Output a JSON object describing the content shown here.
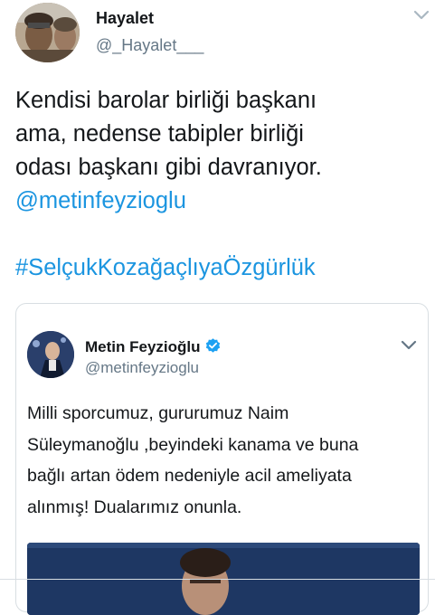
{
  "tweet": {
    "author_name": "Hayalet",
    "author_handle": "@_Hayalet___",
    "text_lines": [
      "Kendisi barolar birliği başkanı",
      "ama, nedense tabipler birliği",
      "odası başkanı gibi davranıyor."
    ],
    "mention": "@metinfeyzioglu",
    "hashtag": "#SelçukKozağaçlıyaÖzgürlük"
  },
  "quoted_tweet": {
    "author_name": "Metin Feyzioğlu",
    "author_handle": "@metinfeyzioglu",
    "verified": true,
    "text_lines": [
      "Milli sporcumuz, gururumuz Naim",
      "Süleymanoğlu ,beyindeki kanama ve buna",
      "bağlı artan ödem nedeniyle acil ameliyata",
      "alınmış! Dualarımız onunla."
    ]
  },
  "icons": {
    "menu": "chevron-down-icon",
    "verified": "verified-badge-icon"
  },
  "colors": {
    "link": "#1b95e0",
    "secondary_text": "#657786",
    "verified": "#1da1f2",
    "border": "#d8dee2"
  }
}
